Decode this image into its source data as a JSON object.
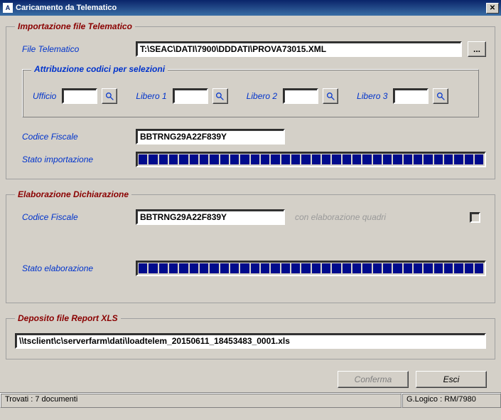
{
  "window": {
    "title": "Caricamento da Telematico"
  },
  "import": {
    "legend": "Importazione file Telematico",
    "file_label": "File Telematico",
    "file_value": "T:\\SEAC\\DATI\\7900\\DDDATI\\PROVA73015.XML",
    "browse_label": "...",
    "attrib": {
      "legend": "Attribuzione codici per selezioni",
      "ufficio_label": "Ufficio",
      "ufficio_value": "",
      "lib1_label": "Libero 1",
      "lib1_value": "",
      "lib2_label": "Libero 2",
      "lib2_value": "",
      "lib3_label": "Libero 3",
      "lib3_value": ""
    },
    "cf_label": "Codice Fiscale",
    "cf_value": "BBTRNG29A22F839Y",
    "stato_label": "Stato importazione",
    "progress_segments": 34
  },
  "elab": {
    "legend": "Elaborazione Dichiarazione",
    "cf_label": "Codice Fiscale",
    "cf_value": "BBTRNG29A22F839Y",
    "con_elab_label": "con elaborazione quadri",
    "stato_label": "Stato elaborazione",
    "progress_segments": 34
  },
  "deposit": {
    "legend": "Deposito file Report XLS",
    "path": "\\\\tsclient\\c\\serverfarm\\dati\\loadtelem_20150611_18453483_0001.xls"
  },
  "buttons": {
    "conferma": "Conferma",
    "esci": "Esci"
  },
  "status": {
    "left": "Trovati : 7 documenti",
    "right": "G.Logico : RM/7980"
  }
}
